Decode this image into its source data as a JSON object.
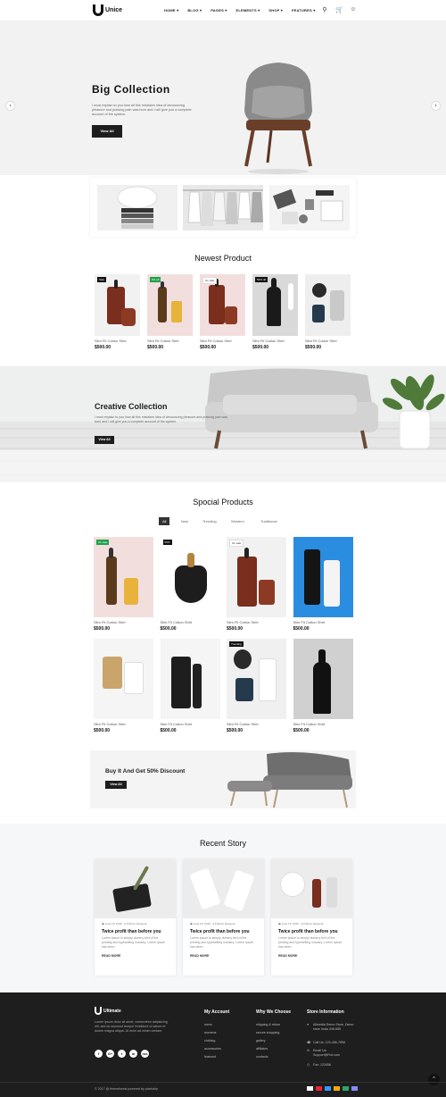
{
  "header": {
    "logo_text": "Unice",
    "nav": [
      "HOME",
      "BLOG",
      "PAGES",
      "ELEMENTS",
      "SHOP",
      "FEATURES"
    ],
    "icons": [
      "search-icon",
      "cart-icon",
      "user-icon"
    ]
  },
  "hero": {
    "title": "Big Collection",
    "description": "I must explain to you how all this mistaken idea of denouncing pleasure and praising pain was born and I will give you a complete account of the system.",
    "button": "View All",
    "prev": "‹",
    "next": "›"
  },
  "newest": {
    "title": "Newest Product",
    "products": [
      {
        "name": "Slim Fit Cotton Shirt",
        "price": "$500.00",
        "badge": "Sale",
        "badge_style": "dark"
      },
      {
        "name": "Slim Fit Cotton Shirt",
        "price": "$500.00",
        "badge": "5% off",
        "badge_style": "green"
      },
      {
        "name": "Slim Fit Cotton Shirt",
        "price": "$500.00",
        "badge": "On sale",
        "badge_style": "white"
      },
      {
        "name": "Slim Fit Cotton Shirt",
        "price": "$500.00",
        "badge": "50% off",
        "badge_style": "dark"
      },
      {
        "name": "Slim Fit Cotton Shirt",
        "price": "$500.00",
        "badge": "",
        "badge_style": ""
      }
    ]
  },
  "creative": {
    "title": "Creative Collection",
    "description": "I must explain to you how all this mistaken idea of denouncing pleasure and praising pain was born and I will give you a complete account of the system.",
    "button": "View All"
  },
  "special": {
    "title": "Spocial Products",
    "tabs": [
      "All",
      "New",
      "Trending",
      "Western",
      "Traditional"
    ],
    "products": [
      {
        "name": "Slim Fit Cotton Shirt",
        "price": "$500.00",
        "badge": "On sale",
        "badge_style": "green"
      },
      {
        "name": "Slim Fit Cotton Shirt",
        "price": "$500.00",
        "badge": "50%",
        "badge_style": "dark"
      },
      {
        "name": "Slim Fit Cotton Shirt",
        "price": "$500.00",
        "badge": "On sale",
        "badge_style": "white"
      },
      {
        "name": "Slim Fit Cotton Shirt",
        "price": "$500.00",
        "badge": "",
        "badge_style": ""
      },
      {
        "name": "Slim Fit Cotton Shirt",
        "price": "$500.00",
        "badge": "",
        "badge_style": ""
      },
      {
        "name": "Slim Fit Cotton Shirt",
        "price": "$500.00",
        "badge": "",
        "badge_style": ""
      },
      {
        "name": "Slim Fit Cotton Shirt",
        "price": "$500.00",
        "badge": "Trending",
        "badge_style": "dark"
      },
      {
        "name": "Slim Fit Cotton Shirt",
        "price": "$500.00",
        "badge": "",
        "badge_style": ""
      }
    ]
  },
  "discount": {
    "title": "Buy It And Get 50% Discount",
    "button": "View All"
  },
  "stories": {
    "title": "Recent Story",
    "items": [
      {
        "date": "June 19, 2016",
        "author": "Pranics Newyork",
        "title": "Twice profit than before you",
        "desc": "Lorem ipsum is simply dummy text of the printing and typesetting industry. Lorem ipsum has been.",
        "more": "READ MORE"
      },
      {
        "date": "June 19, 2016",
        "author": "Pranics Newyork",
        "title": "Twice profit than before you",
        "desc": "Lorem ipsum is simply dummy text of the printing and typesetting industry. Lorem ipsum has been.",
        "more": "READ MORE"
      },
      {
        "date": "June 19, 2016",
        "author": "Pranics Newyork",
        "title": "Twice profit than before you",
        "desc": "Lorem ipsum is simply dummy text of the printing and typesetting industry. Lorem ipsum has been.",
        "more": "READ MORE"
      }
    ]
  },
  "footer": {
    "logo_text": "Ultimate",
    "about": "Lorem ipsum dolor sit amet, consectetur adipisicing elit, sed do eiusmod tempor incididunt ut labore et dolore magna aliqua. Ut enim ad minim veniam.",
    "socials": [
      "f",
      "G+",
      "t",
      "in",
      "rss"
    ],
    "my_account": {
      "title": "My Account",
      "links": [
        "mens",
        "womens",
        "clothing",
        "accessories",
        "featured"
      ]
    },
    "why": {
      "title": "Why We Choose",
      "links": [
        "shipping & return",
        "secure shopping",
        "gallery",
        "affiliates",
        "contacts"
      ]
    },
    "store": {
      "title": "Store Information",
      "address": "Allmedia Demo Store, Demo store India 345-655",
      "call": "Call Us: 123-456-7898",
      "email": "Email Us: Support@Fiot.com",
      "fax": "Fax: 123456"
    },
    "copyright": "© 2017 @ themeforest powered by pixelstrip",
    "top": "^"
  }
}
